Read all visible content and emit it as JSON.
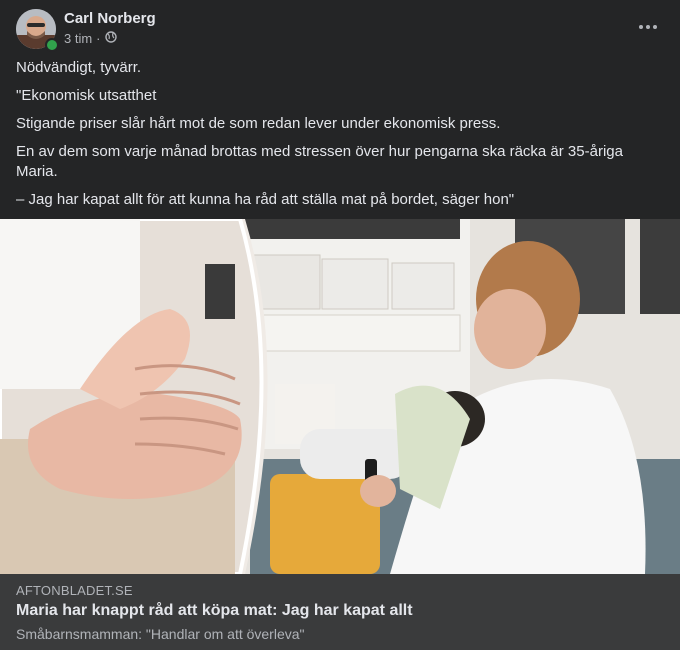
{
  "post": {
    "author": "Carl Norberg",
    "time": "3 tim",
    "separator": "·",
    "privacy_icon": "globe-icon",
    "lines": [
      "Nödvändigt, tyvärr.",
      "\"Ekonomisk utsatthet",
      "Stigande priser slår hårt mot de som redan lever under ekonomisk press.",
      "En av dem som varje månad brottas med stressen över hur pengarna ska räcka är 35-åriga Maria.",
      "– Jag har kapat allt för att kunna ha råd att ställa mat på bordet, säger hon\""
    ]
  },
  "link": {
    "domain": "AFTONBLADET.SE",
    "title": "Maria har knappt råd att köpa mat: Jag har kapat allt",
    "subtitle": "Småbarnsmamman: \"Handlar om att överleva\""
  },
  "colors": {
    "background": "#242526",
    "link_bar": "#3a3b3c",
    "online": "#31a24c"
  }
}
